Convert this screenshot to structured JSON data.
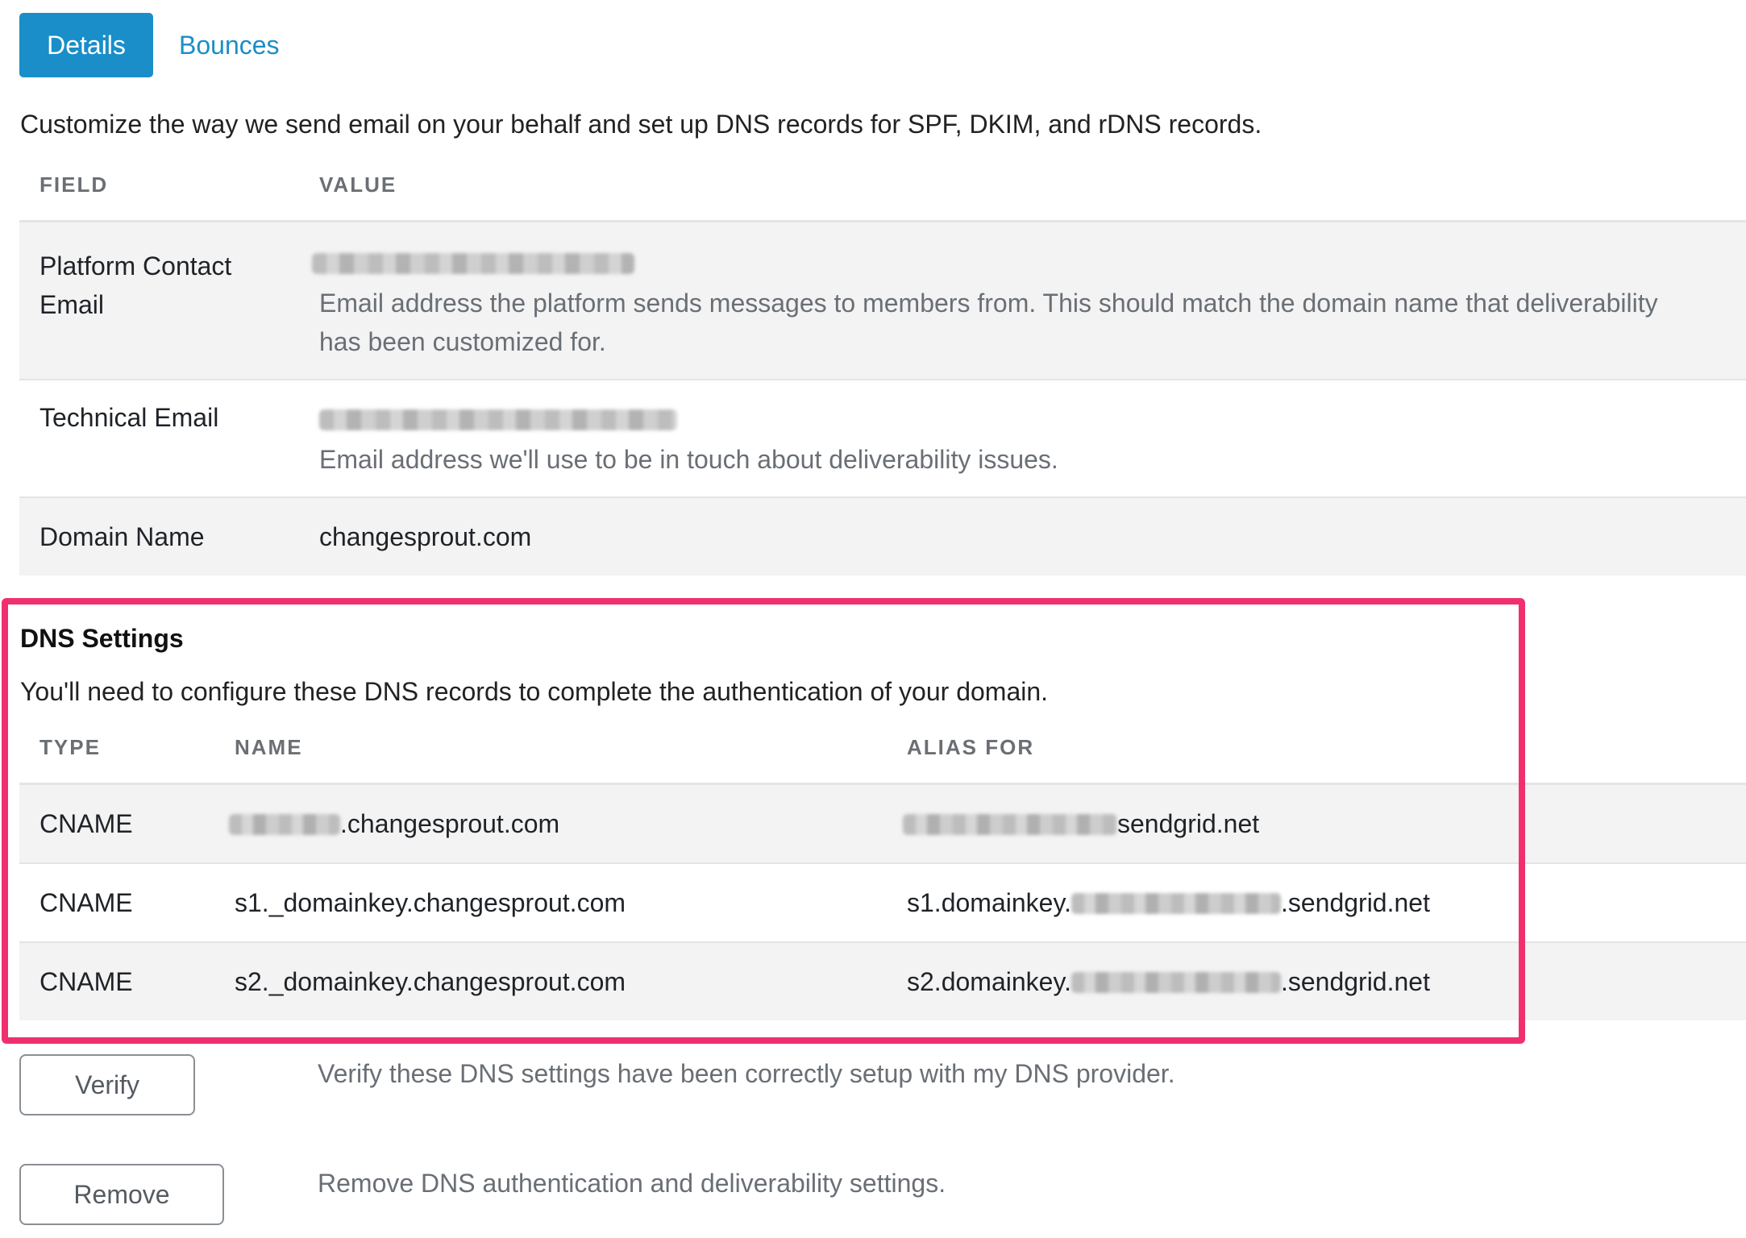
{
  "tabs": [
    {
      "label": "Details",
      "active": true
    },
    {
      "label": "Bounces",
      "active": false
    }
  ],
  "intro": "Customize the way we send email on your behalf and set up DNS records for SPF, DKIM, and rDNS records.",
  "details_table": {
    "headers": [
      "FIELD",
      "VALUE"
    ],
    "rows": [
      {
        "field_line1": "Platform Contact",
        "field_line2": "Email",
        "help_line1": "Email address the platform sends messages to members from. This should match the domain name that deliverability",
        "help_line2": "has been customized for."
      },
      {
        "field": "Technical Email",
        "help": "Email address we'll use to be in touch about deliverability issues."
      },
      {
        "field": "Domain Name",
        "value": "changesprout.com"
      }
    ]
  },
  "dns": {
    "title": "DNS Settings",
    "description": "You'll need to configure these DNS records to complete the authentication of your domain.",
    "headers": [
      "TYPE",
      "NAME",
      "ALIAS FOR"
    ],
    "rows": [
      {
        "type": "CNAME",
        "name_suffix": ".changesprout.com",
        "alias_prefix": "",
        "alias_suffix": "sendgrid.net"
      },
      {
        "type": "CNAME",
        "name": "s1._domainkey.changesprout.com",
        "alias_prefix": "s1.domainkey.",
        "alias_suffix": ".sendgrid.net"
      },
      {
        "type": "CNAME",
        "name": "s2._domainkey.changesprout.com",
        "alias_prefix": "s2.domainkey.",
        "alias_suffix": ".sendgrid.net"
      }
    ]
  },
  "actions": {
    "verify_label": "Verify",
    "verify_desc": "Verify these DNS settings have been correctly setup with my DNS provider.",
    "remove_label": "Remove",
    "remove_desc": "Remove DNS authentication and deliverability settings."
  },
  "colors": {
    "accent": "#1a8ec8",
    "highlight_border": "#f0306e"
  }
}
